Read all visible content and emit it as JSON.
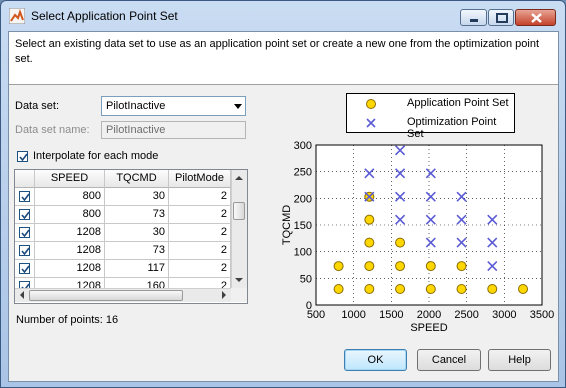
{
  "window": {
    "title": "Select Application Point Set",
    "controls": [
      "minimize-icon",
      "maximize-icon",
      "close-icon"
    ]
  },
  "description": "Select an existing data set to use as an application point set or create a new one from the optimization point set.",
  "form": {
    "data_set_label": "Data set:",
    "data_set_value": "PilotInactive",
    "data_set_name_label": "Data set name:",
    "data_set_name_value": "PilotInactive",
    "interpolate_label": "Interpolate for each mode",
    "interpolate_checked": true
  },
  "table": {
    "columns": [
      "SPEED",
      "TQCMD",
      "PilotMode"
    ],
    "rows": [
      {
        "checked": true,
        "speed": "800",
        "tqcmd": "30",
        "mode": "2"
      },
      {
        "checked": true,
        "speed": "800",
        "tqcmd": "73",
        "mode": "2"
      },
      {
        "checked": true,
        "speed": "1208",
        "tqcmd": "30",
        "mode": "2"
      },
      {
        "checked": true,
        "speed": "1208",
        "tqcmd": "73",
        "mode": "2"
      },
      {
        "checked": true,
        "speed": "1208",
        "tqcmd": "117",
        "mode": "2"
      },
      {
        "checked": true,
        "speed": "1208",
        "tqcmd": "160",
        "mode": "2"
      }
    ]
  },
  "points_label": "Number of points: 16",
  "buttons": {
    "ok": "OK",
    "cancel": "Cancel",
    "help": "Help"
  },
  "colors": {
    "application": "#ffd700",
    "optimization": "#5b5bd6"
  },
  "chart_data": {
    "type": "scatter",
    "xlabel": "SPEED",
    "ylabel": "TQCMD",
    "xlim": [
      500,
      3500
    ],
    "ylim": [
      0,
      300
    ],
    "xticks": [
      500,
      1000,
      1500,
      2000,
      2500,
      3000,
      3500
    ],
    "yticks": [
      0,
      50,
      100,
      150,
      200,
      250,
      300
    ],
    "grid": true,
    "legend_position": "top",
    "series": [
      {
        "name": "Application Point Set",
        "marker": "circle",
        "points": [
          [
            800,
            30
          ],
          [
            800,
            73
          ],
          [
            1208,
            30
          ],
          [
            1208,
            73
          ],
          [
            1208,
            117
          ],
          [
            1208,
            160
          ],
          [
            1208,
            203
          ],
          [
            1616,
            30
          ],
          [
            1616,
            73
          ],
          [
            1616,
            117
          ],
          [
            2024,
            30
          ],
          [
            2024,
            73
          ],
          [
            2432,
            30
          ],
          [
            2432,
            73
          ],
          [
            2840,
            30
          ],
          [
            3248,
            30
          ]
        ]
      },
      {
        "name": "Optimization Point Set",
        "marker": "x",
        "points": [
          [
            1208,
            247
          ],
          [
            1208,
            203
          ],
          [
            1616,
            290
          ],
          [
            1616,
            247
          ],
          [
            1616,
            203
          ],
          [
            1616,
            160
          ],
          [
            2024,
            247
          ],
          [
            2024,
            203
          ],
          [
            2024,
            160
          ],
          [
            2024,
            117
          ],
          [
            2432,
            203
          ],
          [
            2432,
            160
          ],
          [
            2432,
            117
          ],
          [
            2840,
            160
          ],
          [
            2840,
            117
          ],
          [
            2840,
            73
          ]
        ]
      }
    ]
  }
}
